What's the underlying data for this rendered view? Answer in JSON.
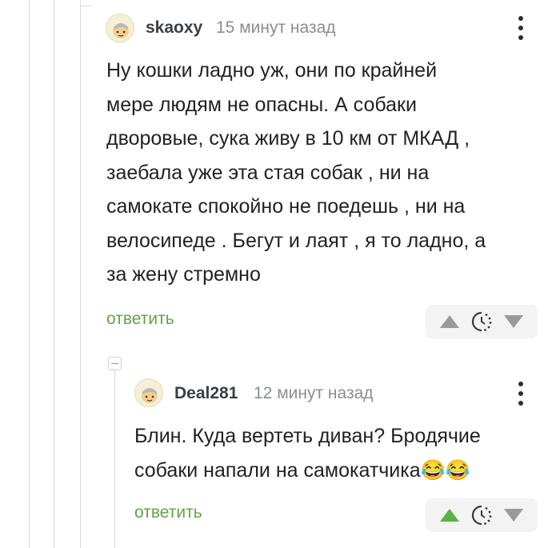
{
  "comments": [
    {
      "username": "skaoxy",
      "time": "15 минут назад",
      "lines": [
        "Ну кошки ладно уж, они по крайней",
        "мере людям не опасны. А собаки",
        "дворовые, сука живу в 10 км от МКАД ,",
        "заебала уже эта стая собак , ни на",
        "самокате спокойно не поедешь , ни на",
        "велосипеде . Бегут и лаят , я то ладно, а",
        "за жену стремно"
      ],
      "reply_label": "ответить"
    },
    {
      "username": "Deal281",
      "time": "12 минут назад",
      "lines": [
        "Блин. Куда вертеть диван? Бродячие",
        "собаки напали на самокатчика😂😂"
      ],
      "reply_label": "ответить"
    }
  ],
  "colors": {
    "upvote_active": "#5bb347",
    "vote_inactive": "#9a9a9a",
    "reply_link": "#64a24a"
  },
  "icons": {
    "upvote": "triangle-up-icon",
    "downvote": "triangle-down-icon",
    "rating_hidden": "clock-dotted-icon",
    "menu": "more-vertical-icon",
    "collapse": "minus-square-icon"
  }
}
